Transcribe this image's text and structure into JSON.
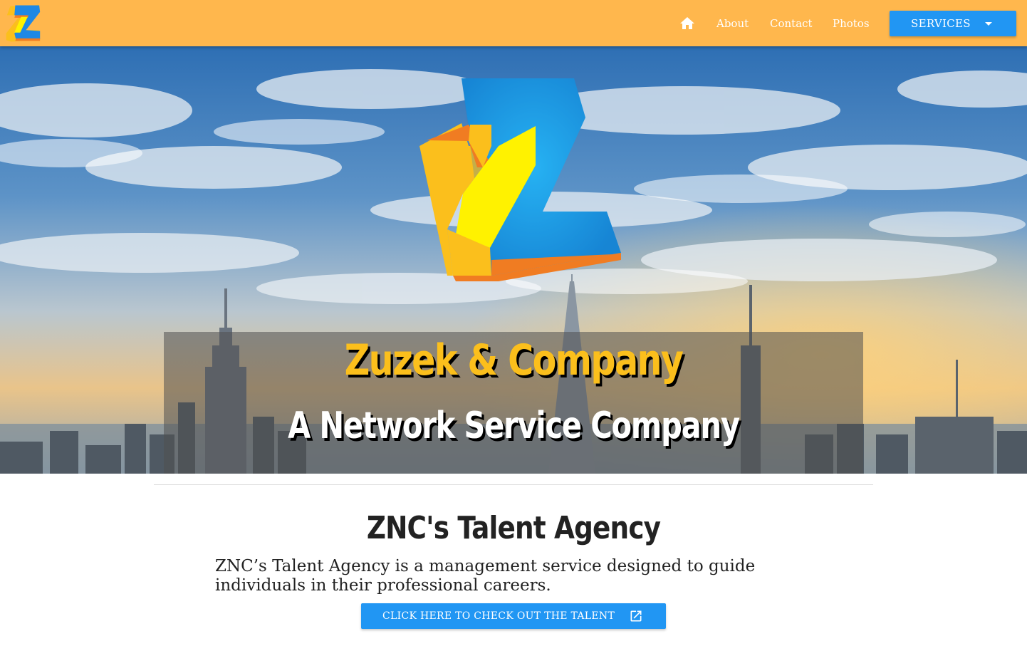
{
  "brand": {
    "colors": {
      "navbar": "#ffb74d",
      "primary_button": "#2196f3",
      "title_yellow": "#fbbf1c",
      "logo_blue": "#1e88e5",
      "logo_orange": "#f07c22"
    },
    "logo_icon": "z-logo-icon"
  },
  "nav": {
    "home_icon": "home-icon",
    "links": [
      {
        "label": "About"
      },
      {
        "label": "Contact"
      },
      {
        "label": "Photos"
      }
    ],
    "services": {
      "label": "SERVICES",
      "icon": "caret-down-icon"
    }
  },
  "hero": {
    "title": "Zuzek & Company",
    "subtitle": "A Network Service Company"
  },
  "section": {
    "title": "ZNC's Talent Agency",
    "description": "ZNC’s Talent Agency is a management service designed to guide individuals in their professional careers.",
    "button": {
      "label": "CLICK HERE TO CHECK OUT THE TALENT",
      "icon": "external-link-icon"
    }
  }
}
